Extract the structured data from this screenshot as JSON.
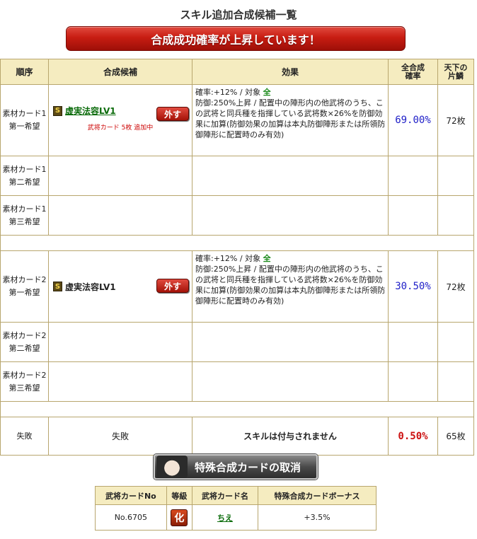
{
  "title": "スキル追加合成候補一覧",
  "banner": "合成成功確率が上昇しています！",
  "headers": {
    "order": "順序",
    "candidate": "合成候補",
    "effect": "効果",
    "total_rate": "全合成確率",
    "tenka": "天下の片鱗"
  },
  "groups": [
    {
      "rows": [
        {
          "order1": "素材カード1",
          "order2": "第一希望",
          "skill_icon": "S",
          "skill_name": "虚実法容LV1",
          "remove": "外す",
          "note": "武将カード 5枚 追加中",
          "effect_rate": "確率:+12% / 対象",
          "effect_target": "全",
          "effect_body": "防御:250%上昇 / 配置中の陣形内の他武将のうち、この武将と同兵種を指揮している武将数×26%を防御効果に加算(防御効果の加算は本丸防御陣形または所領防御陣形に配置時のみ有効)",
          "rate": "69.00%",
          "count": "72枚"
        },
        {
          "order1": "素材カード1",
          "order2": "第二希望"
        },
        {
          "order1": "素材カード1",
          "order2": "第三希望"
        }
      ]
    },
    {
      "rows": [
        {
          "order1": "素材カード2",
          "order2": "第一希望",
          "skill_icon": "S",
          "skill_name": "虚実法容LV1",
          "remove": "外す",
          "effect_rate": "確率:+12% / 対象",
          "effect_target": "全",
          "effect_body": "防御:250%上昇 / 配置中の陣形内の他武将のうち、この武将と同兵種を指揮している武将数×26%を防御効果に加算(防御効果の加算は本丸防御陣形または所領防御陣形に配置時のみ有効)",
          "rate": "30.50%",
          "count": "72枚"
        },
        {
          "order1": "素材カード2",
          "order2": "第二希望"
        },
        {
          "order1": "素材カード2",
          "order2": "第三希望"
        }
      ]
    }
  ],
  "failure": {
    "order": "失敗",
    "candidate": "失敗",
    "message": "スキルは付与されません",
    "rate": "0.50%",
    "count": "65枚"
  },
  "cancel_button": "特殊合成カードの取消",
  "card_table": {
    "headers": [
      "武将カードNo",
      "等級",
      "武将カード名",
      "特殊合成カードボーナス"
    ],
    "no": "No.6705",
    "rank": "化",
    "name": "ちえ",
    "bonus": "+3.5%"
  },
  "colors": {
    "header_bg": "#f5ecc0",
    "banner_red": "#c81d12",
    "rate_blue": "#2020c8",
    "rate_red": "#cc1111",
    "link_green": "#0a6b0a"
  }
}
